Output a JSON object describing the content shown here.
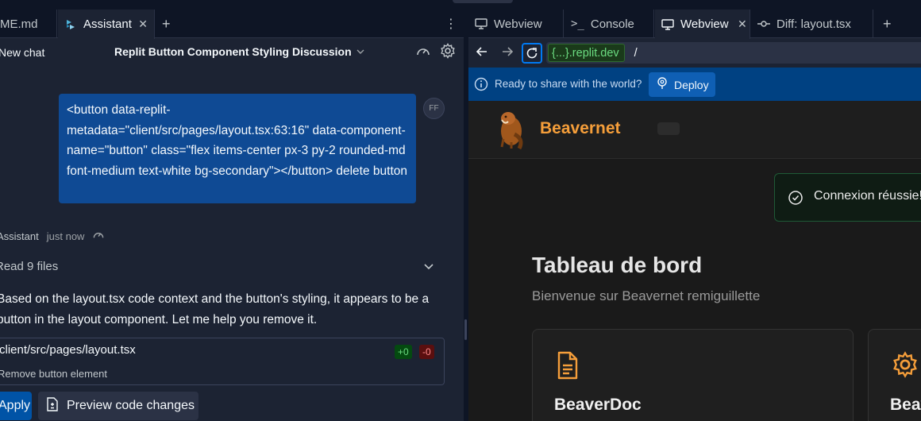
{
  "left": {
    "tabs": [
      {
        "label": "ME.md"
      },
      {
        "label": "Assistant"
      }
    ],
    "chat": {
      "new_chat": "New chat",
      "title": "Replit Button Component Styling Discussion"
    },
    "user_message": "<button data-replit-metadata=\"client/src/pages/layout.tsx:63:16\" data-component-name=\"button\" class=\"flex items-center px-3 py-2 rounded-md font-medium text-white bg-secondary\"></button> delete button",
    "avatar_initials": "FF",
    "assistant": {
      "name": "Assistant",
      "time": "just now",
      "read_files": "Read 9 files",
      "body": "Based on the layout.tsx code context and the button's styling, it appears to be a button in the layout component. Let me help you remove it.",
      "file": {
        "path": "client/src/pages/layout.tsx",
        "description": "Remove button element",
        "added": "+0",
        "removed": "-0"
      },
      "apply_label": "Apply",
      "preview_label": "Preview code changes"
    }
  },
  "right": {
    "tabs": [
      {
        "label": "Webview"
      },
      {
        "label": "Console"
      },
      {
        "label": "Webview"
      },
      {
        "label": "Diff: layout.tsx"
      }
    ],
    "url": {
      "host": "{...}.replit.dev",
      "path": "/"
    },
    "share": {
      "message": "Ready to share with the world?",
      "deploy_label": "Deploy"
    },
    "site": {
      "brand": "Beavernet",
      "toast": "Connexion réussie!",
      "title": "Tableau de bord",
      "subtitle": "Bienvenue sur Beavernet remiguillette",
      "cards": [
        {
          "name": "BeaverDoc"
        },
        {
          "name": "Beav"
        }
      ]
    }
  },
  "colors": {
    "user_bubble": "#0f4a94",
    "brand": "#f59e3a",
    "share_bar": "#004182",
    "toast_border": "#1f5a36"
  }
}
